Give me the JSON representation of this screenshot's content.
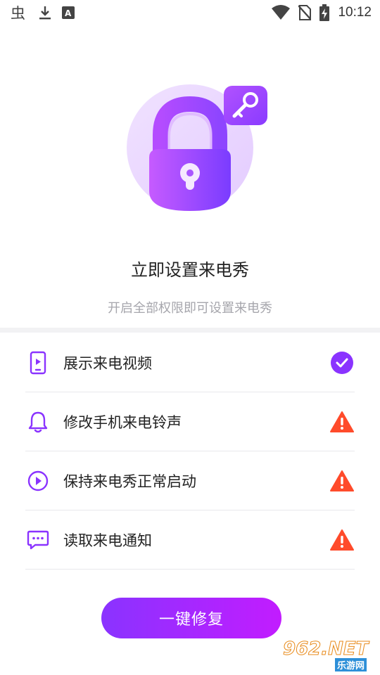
{
  "status_bar": {
    "time": "10:12",
    "left_icons": [
      "bug-icon",
      "download-icon",
      "font-a-icon"
    ],
    "right_icons": [
      "wifi-icon",
      "no-sim-icon",
      "battery-charging-icon"
    ]
  },
  "hero": {
    "illustration": "padlock-key-icon",
    "title": "立即设置来电秀",
    "subtitle": "开启全部权限即可设置来电秀"
  },
  "permissions": [
    {
      "label": "展示来电视频",
      "icon": "phone-video-icon",
      "status": "granted",
      "status_icon": "check-circle-icon"
    },
    {
      "label": "修改手机来电铃声",
      "icon": "bell-icon",
      "status": "missing",
      "status_icon": "warning-icon"
    },
    {
      "label": "保持来电秀正常启动",
      "icon": "play-circle-icon",
      "status": "missing",
      "status_icon": "warning-icon"
    },
    {
      "label": "读取来电通知",
      "icon": "message-icon",
      "status": "missing",
      "status_icon": "warning-icon"
    }
  ],
  "fix_button": {
    "label": "一键修复"
  },
  "watermark": {
    "main": "962.NET",
    "sub": "乐游网"
  },
  "colors": {
    "accent": "#8a33ff",
    "accent_end": "#c21cff",
    "warning": "#ff4b2b",
    "muted_text": "#a6a6ac"
  }
}
